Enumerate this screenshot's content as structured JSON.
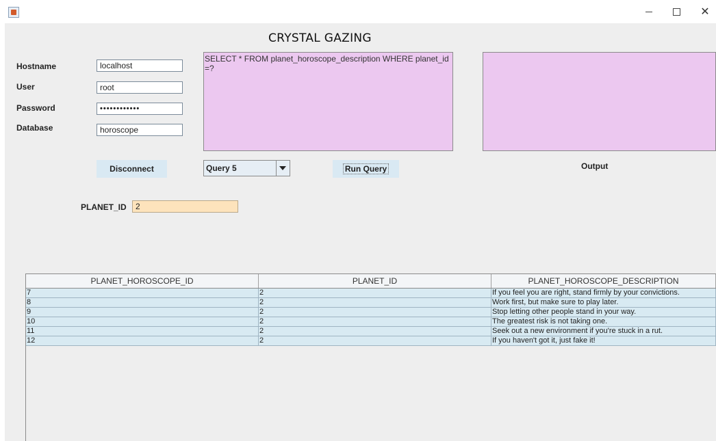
{
  "window": {
    "title": "",
    "controls": {
      "minimize": "minimize",
      "maximize": "maximize",
      "close": "✕"
    }
  },
  "app": {
    "title": "CRYSTAL GAZING"
  },
  "connection": {
    "hostname_label": "Hostname",
    "hostname_value": "localhost",
    "user_label": "User",
    "user_value": "root",
    "password_label": "Password",
    "password_value": "••••••••••••",
    "database_label": "Database",
    "database_value": "horoscope",
    "disconnect_label": "Disconnect"
  },
  "query": {
    "sql_text": "SELECT * FROM planet_horoscope_description WHERE planet_id=?",
    "selected_query": "Query 5",
    "run_label": "Run Query"
  },
  "output": {
    "label": "Output"
  },
  "param": {
    "label": "PLANET_ID",
    "value": "2"
  },
  "table": {
    "headers": [
      "PLANET_HOROSCOPE_ID",
      "PLANET_ID",
      "PLANET_HOROSCOPE_DESCRIPTION"
    ],
    "rows": [
      [
        "7",
        "2",
        "If you feel you are right, stand firmly by your convictions."
      ],
      [
        "8",
        "2",
        "Work first, but make sure to play later."
      ],
      [
        "9",
        "2",
        "Stop letting other people stand in your way."
      ],
      [
        "10",
        "2",
        "The greatest risk is not taking one."
      ],
      [
        "11",
        "2",
        "Seek out a new environment if you're stuck in a rut."
      ],
      [
        "12",
        "2",
        "If you haven't got it, just fake it!"
      ]
    ]
  },
  "colors": {
    "query_area_bg": "#ecc8f0",
    "button_bg": "#d9e9f3",
    "param_input_bg": "#fde3bc",
    "row_bg": "#d8eaf2",
    "panel_bg": "#eeeeee"
  },
  "icons": {
    "app": "java-cup-icon",
    "combo_arrow": "chevron-down-icon"
  }
}
